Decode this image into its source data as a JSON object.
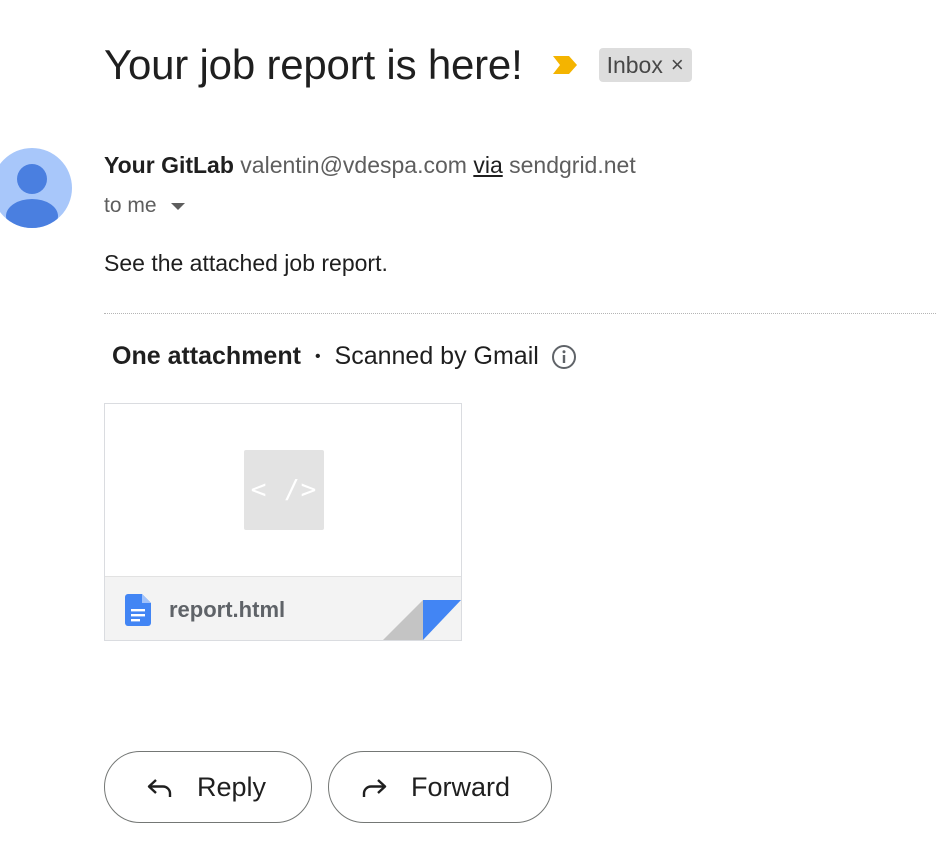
{
  "email": {
    "subject": "Your job report is here!",
    "label": "Inbox",
    "label_remove_glyph": "×",
    "importance_marker_color": "#f4b400",
    "sender": {
      "name": "Your GitLab",
      "email": "valentin@vdespa.com",
      "via_word": "via",
      "via_domain": "sendgrid.net"
    },
    "recipient_text": "to me",
    "body": "See the attached job report.",
    "icons": {
      "avatar": "person-avatar",
      "importance": "importance-marker-icon",
      "recipient_dropdown": "caret-down-icon",
      "info": "info-icon",
      "file_type": "docs-file-icon",
      "reply": "reply-arrow-icon",
      "forward": "forward-arrow-icon"
    }
  },
  "attachments": {
    "count_label": "One attachment",
    "separator": "•",
    "scan_status": "Scanned by Gmail",
    "items": [
      {
        "preview_glyph": "< />",
        "filename": "report.html",
        "file_icon_color": "#4285f4"
      }
    ]
  },
  "actions": {
    "reply_label": "Reply",
    "forward_label": "Forward"
  },
  "colors": {
    "avatar_background": "#a8c7fa",
    "avatar_figure": "#4a7fe0",
    "fold_blue": "#4285f4"
  }
}
